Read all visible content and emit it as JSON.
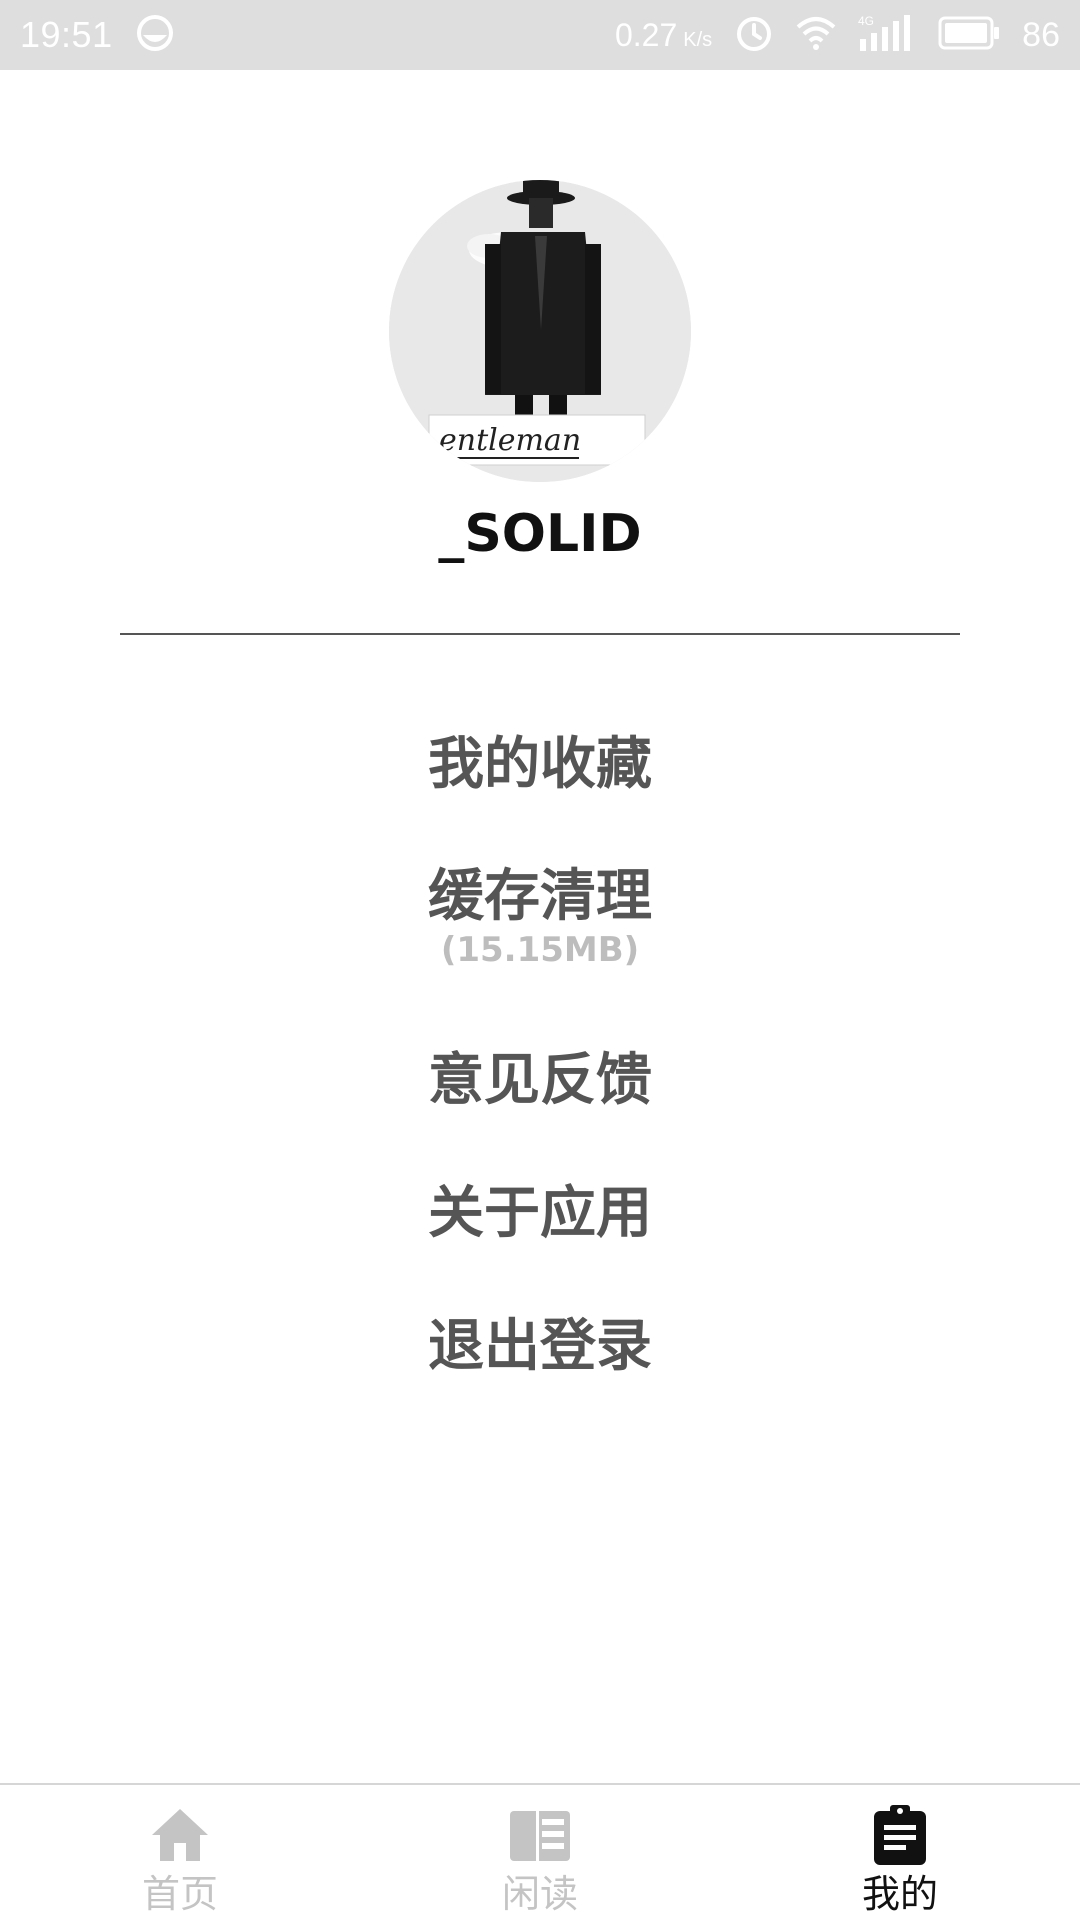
{
  "status_bar": {
    "time": "19:51",
    "speed_value": "0.27",
    "speed_unit": "K/s",
    "network": "4G",
    "battery": "86"
  },
  "profile": {
    "username": "_SOLID",
    "avatar_caption": "entleman"
  },
  "menu": {
    "favorites": "我的收藏",
    "cache_clear": "缓存清理",
    "cache_size": "(15.15MB)",
    "feedback": "意见反馈",
    "about": "关于应用",
    "logout": "退出登录"
  },
  "bottom_nav": {
    "items": [
      {
        "label": "首页",
        "icon": "home-icon",
        "active": false
      },
      {
        "label": "闲读",
        "icon": "reader-icon",
        "active": false
      },
      {
        "label": "我的",
        "icon": "clipboard-icon",
        "active": true
      }
    ]
  },
  "colors": {
    "status_bar_bg": "#dedede",
    "menu_text": "#555555",
    "menu_subtext": "#bdbdbd",
    "nav_active": "#111111",
    "nav_inactive": "#c4c4c4"
  }
}
